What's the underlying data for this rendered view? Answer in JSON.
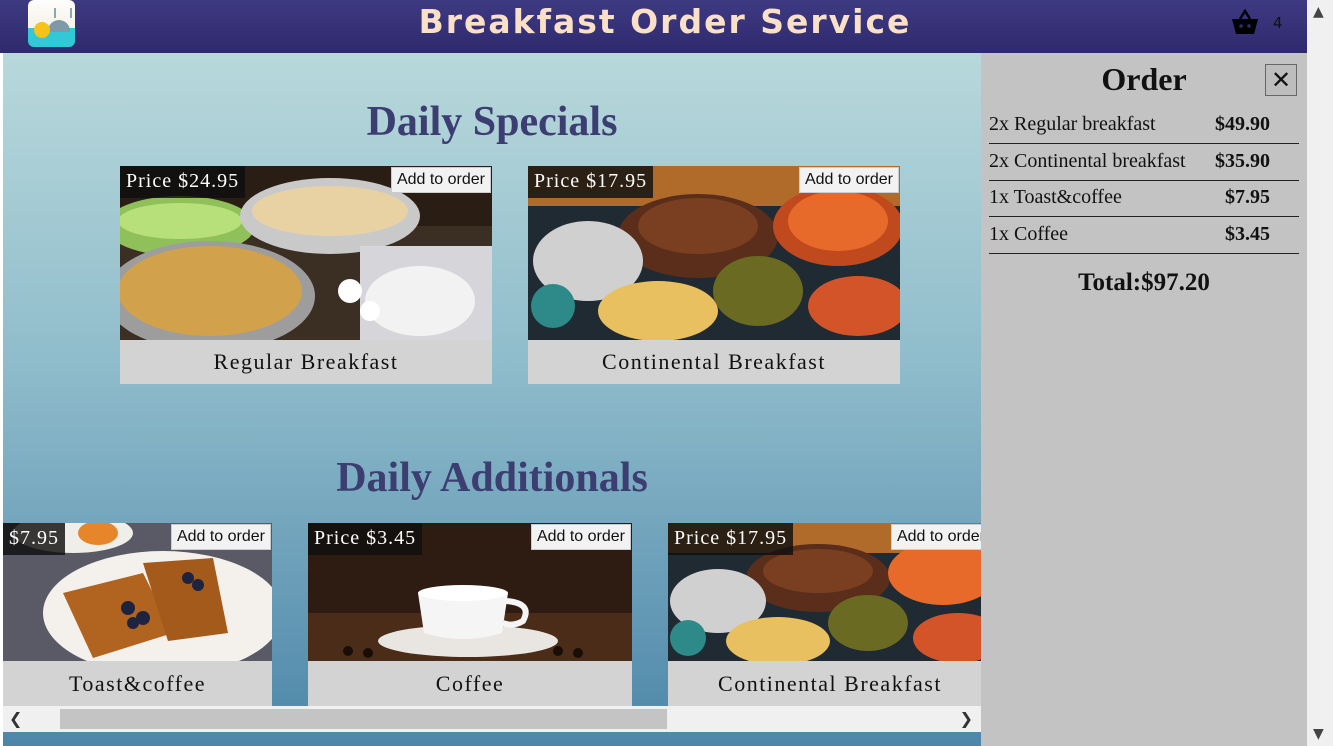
{
  "header": {
    "title": "Breakfast Order Service",
    "cart_count": "4"
  },
  "specials": {
    "title": "Daily Specials",
    "cards": [
      {
        "name": "Regular Breakfast",
        "price": "Price $24.95",
        "add_label": "Add to order"
      },
      {
        "name": "Continental Breakfast",
        "price": "Price $17.95",
        "add_label": "Add to order"
      }
    ]
  },
  "additionals": {
    "title": "Daily Additionals",
    "cards": [
      {
        "name": "Toast&coffee",
        "price": "$7.95",
        "add_label": "Add to order"
      },
      {
        "name": "Coffee",
        "price": "Price $3.45",
        "add_label": "Add to order"
      },
      {
        "name": "Continental Breakfast",
        "price": "Price $17.95",
        "add_label": "Add to order"
      }
    ]
  },
  "order": {
    "title": "Order",
    "close_label": "✕",
    "lines": [
      {
        "item": "2x Regular breakfast",
        "amount": "$49.90"
      },
      {
        "item": "2x Continental breakfast",
        "amount": "$35.90"
      },
      {
        "item": "1x Toast&coffee",
        "amount": "$7.95"
      },
      {
        "item": "1x Coffee",
        "amount": "$3.45"
      }
    ],
    "total": "Total:$97.20"
  },
  "colors": {
    "header": "#2f2a6e",
    "title_text": "#fbe0c8",
    "section_title": "#3c3e72",
    "sidebar": "#c3c3c3"
  },
  "icons": [
    "logo-icon",
    "cart-icon",
    "close-icon",
    "scroll-left-icon",
    "scroll-right-icon",
    "scroll-up-icon",
    "scroll-down-icon"
  ]
}
